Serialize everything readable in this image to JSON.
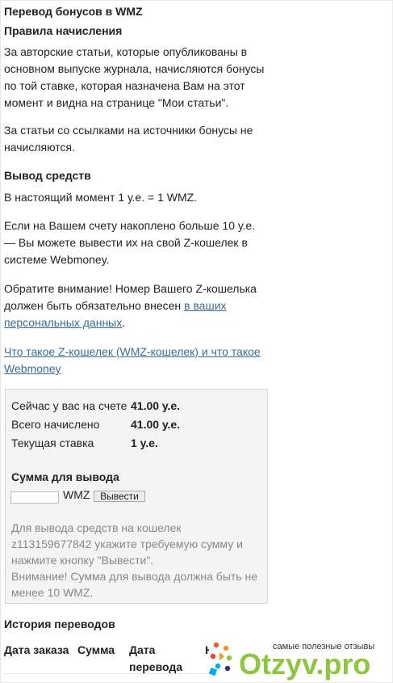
{
  "page_title": "Перевод бонусов в WMZ",
  "rules": {
    "title": "Правила начисления",
    "para1": [
      "За авторские статьи, которые опубликованы в",
      "основном выпуске журнала, начисляются бонусы",
      "по той ставке, которая назначена Вам на этот",
      "момент и видна на странице \"Мои статьи\"."
    ],
    "para2": [
      "За статьи со ссылками на источники бонусы не",
      "начисляются."
    ]
  },
  "withdraw": {
    "title": "Вывод средств",
    "rate_line": "В настоящий момент 1 у.е. = 1 WMZ.",
    "para_limit": [
      "Если на Вашем счету накоплено больше 10 у.е.",
      "— Вы можете вывести их на свой Z-кошелек в",
      "системе Webmoney."
    ],
    "attention_line1": "Обратите внимание! Номер Вашего Z-кошелька",
    "attention_line2_prefix": "должен быть обязательно внесен ",
    "attention_link_part1": "в ваших",
    "attention_link_part2": "персональных данных",
    "attention_suffix": ".",
    "faq_link_line1": "Что такое Z-кошелек (WMZ-кошелек) и что такое",
    "faq_link_line2": "Webmoney"
  },
  "balance": {
    "rows": [
      {
        "label": "Сейчас у вас на счете",
        "value": "41.00 у.е."
      },
      {
        "label": "Всего начислено",
        "value": "41.00 у.е."
      },
      {
        "label": "Текущая ставка",
        "value": "1 у.е."
      }
    ],
    "sum_title": "Сумма для вывода",
    "amount_value": "",
    "currency": "WMZ",
    "withdraw_button": "Вывести",
    "note": [
      "Для вывода средств на кошелек",
      "z113159677842 укажите требуемую сумму и",
      "нажмите кнопку \"Вывести\".",
      "Внимание! Сумма для вывода должна быть не",
      "менее 10 WMZ."
    ]
  },
  "history": {
    "title": "История переводов",
    "columns": [
      "Дата заказа",
      "Сумма",
      "Дата перевода",
      "Н"
    ]
  },
  "watermark": {
    "tagline": "самые полезные отзывы",
    "brand": "Otzyv.pro"
  },
  "colors": {
    "link": "#3a6b96",
    "box_bg": "#f4f4f4",
    "note_text": "#888888",
    "brand_green": "#8dc63f"
  }
}
